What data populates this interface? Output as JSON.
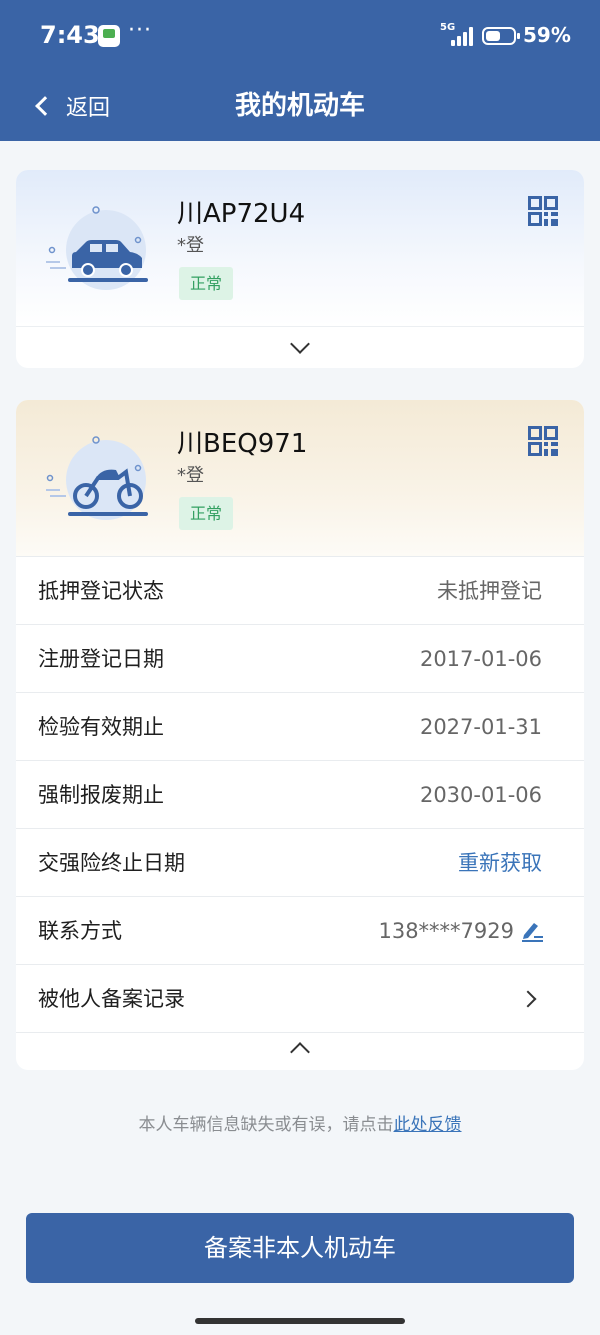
{
  "status_bar": {
    "time": "7:43",
    "more": "···",
    "network": "5G",
    "battery_percent": "59%"
  },
  "nav": {
    "back_label": "返回",
    "title": "我的机动车"
  },
  "vehicles": [
    {
      "plate": "川AP72U4",
      "owner": "*登",
      "status": "正常",
      "type_icon": "car-icon",
      "expanded": false
    },
    {
      "plate": "川BEQ971",
      "owner": "*登",
      "status": "正常",
      "type_icon": "motorcycle-icon",
      "expanded": true,
      "details": [
        {
          "label": "抵押登记状态",
          "value": "未抵押登记"
        },
        {
          "label": "注册登记日期",
          "value": "2017-01-06"
        },
        {
          "label": "检验有效期止",
          "value": "2027-01-31"
        },
        {
          "label": "强制报废期止",
          "value": "2030-01-06"
        },
        {
          "label": "交强险终止日期",
          "value": "重新获取"
        },
        {
          "label": "联系方式",
          "value": "138****7929"
        },
        {
          "label": "被他人备案记录",
          "value": ""
        }
      ]
    }
  ],
  "feedback": {
    "text": "本人车辆信息缺失或有误，请点击",
    "link": "此处反馈"
  },
  "main_button": "备案非本人机动车",
  "colors": {
    "header": "#3a64a6",
    "status_green": "#33a061",
    "link_blue": "#3a74b9"
  }
}
